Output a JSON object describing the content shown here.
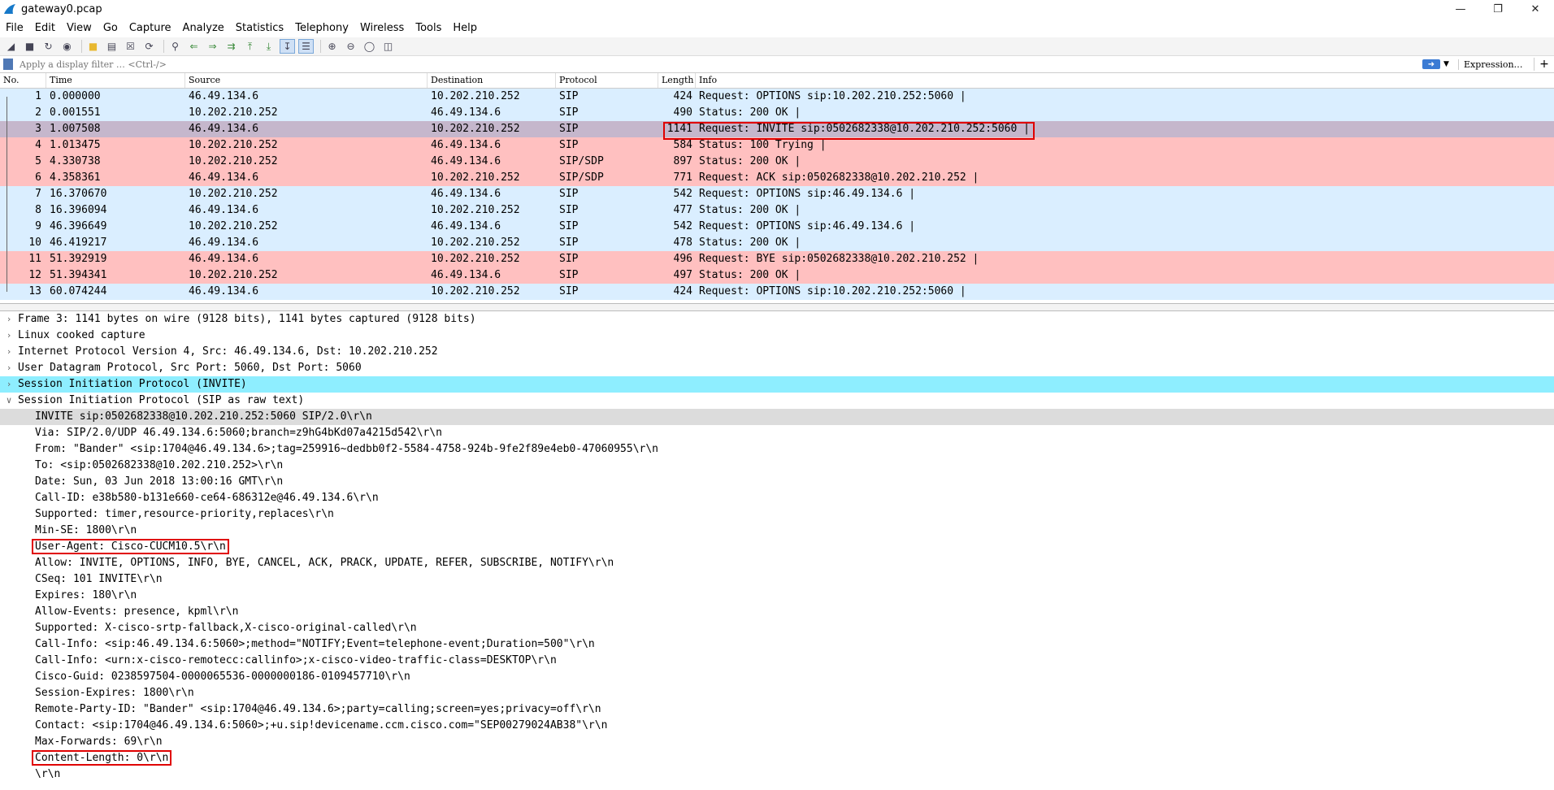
{
  "window": {
    "title": "gateway0.pcap"
  },
  "menu": [
    "File",
    "Edit",
    "View",
    "Go",
    "Capture",
    "Analyze",
    "Statistics",
    "Telephony",
    "Wireless",
    "Tools",
    "Help"
  ],
  "filter": {
    "placeholder": "Apply a display filter … <Ctrl-/>",
    "expression_label": "Expression…",
    "plus": "+"
  },
  "columns": {
    "no": "No.",
    "time": "Time",
    "source": "Source",
    "destination": "Destination",
    "protocol": "Protocol",
    "length": "Length",
    "info": "Info"
  },
  "packets": [
    {
      "no": "1",
      "time": "0.000000",
      "src": "46.49.134.6",
      "dst": "10.202.210.252",
      "proto": "SIP",
      "len": "424",
      "info": "Request: OPTIONS sip:10.202.210.252:5060 |",
      "color": "blue"
    },
    {
      "no": "2",
      "time": "0.001551",
      "src": "10.202.210.252",
      "dst": "46.49.134.6",
      "proto": "SIP",
      "len": "490",
      "info": "Status: 200 OK |",
      "color": "blue"
    },
    {
      "no": "3",
      "time": "1.007508",
      "src": "46.49.134.6",
      "dst": "10.202.210.252",
      "proto": "SIP",
      "len": "1141",
      "info": "Request: INVITE sip:0502682338@10.202.210.252:5060 |",
      "color": "selected"
    },
    {
      "no": "4",
      "time": "1.013475",
      "src": "10.202.210.252",
      "dst": "46.49.134.6",
      "proto": "SIP",
      "len": "584",
      "info": "Status: 100 Trying |",
      "color": "red"
    },
    {
      "no": "5",
      "time": "4.330738",
      "src": "10.202.210.252",
      "dst": "46.49.134.6",
      "proto": "SIP/SDP",
      "len": "897",
      "info": "Status: 200 OK |",
      "color": "red"
    },
    {
      "no": "6",
      "time": "4.358361",
      "src": "46.49.134.6",
      "dst": "10.202.210.252",
      "proto": "SIP/SDP",
      "len": "771",
      "info": "Request: ACK sip:0502682338@10.202.210.252 |",
      "color": "red"
    },
    {
      "no": "7",
      "time": "16.370670",
      "src": "10.202.210.252",
      "dst": "46.49.134.6",
      "proto": "SIP",
      "len": "542",
      "info": "Request: OPTIONS sip:46.49.134.6 |",
      "color": "blue"
    },
    {
      "no": "8",
      "time": "16.396094",
      "src": "46.49.134.6",
      "dst": "10.202.210.252",
      "proto": "SIP",
      "len": "477",
      "info": "Status: 200 OK |",
      "color": "blue"
    },
    {
      "no": "9",
      "time": "46.396649",
      "src": "10.202.210.252",
      "dst": "46.49.134.6",
      "proto": "SIP",
      "len": "542",
      "info": "Request: OPTIONS sip:46.49.134.6 |",
      "color": "blue"
    },
    {
      "no": "10",
      "time": "46.419217",
      "src": "46.49.134.6",
      "dst": "10.202.210.252",
      "proto": "SIP",
      "len": "478",
      "info": "Status: 200 OK |",
      "color": "blue"
    },
    {
      "no": "11",
      "time": "51.392919",
      "src": "46.49.134.6",
      "dst": "10.202.210.252",
      "proto": "SIP",
      "len": "496",
      "info": "Request: BYE sip:0502682338@10.202.210.252 |",
      "color": "red"
    },
    {
      "no": "12",
      "time": "51.394341",
      "src": "10.202.210.252",
      "dst": "46.49.134.6",
      "proto": "SIP",
      "len": "497",
      "info": "Status: 200 OK |",
      "color": "red"
    },
    {
      "no": "13",
      "time": "60.074244",
      "src": "46.49.134.6",
      "dst": "10.202.210.252",
      "proto": "SIP",
      "len": "424",
      "info": "Request: OPTIONS sip:10.202.210.252:5060 |",
      "color": "blue"
    }
  ],
  "details": {
    "layers": [
      {
        "text": "Frame 3: 1141 bytes on wire (9128 bits), 1141 bytes captured (9128 bits)",
        "expanded": false,
        "highlight": false
      },
      {
        "text": "Linux cooked capture",
        "expanded": false,
        "highlight": false
      },
      {
        "text": "Internet Protocol Version 4, Src: 46.49.134.6, Dst: 10.202.210.252",
        "expanded": false,
        "highlight": false
      },
      {
        "text": "User Datagram Protocol, Src Port: 5060, Dst Port: 5060",
        "expanded": false,
        "highlight": false
      },
      {
        "text": "Session Initiation Protocol (INVITE)",
        "expanded": false,
        "highlight": true
      },
      {
        "text": "Session Initiation Protocol (SIP as raw text)",
        "expanded": true,
        "highlight": false
      }
    ],
    "sip_lines": [
      {
        "text": "INVITE sip:0502682338@10.202.210.252:5060 SIP/2.0\\r\\n",
        "style": "grey"
      },
      {
        "text": "Via: SIP/2.0/UDP 46.49.134.6:5060;branch=z9hG4bKd07a4215d542\\r\\n",
        "style": ""
      },
      {
        "text": "From: \"Bander\" <sip:1704@46.49.134.6>;tag=259916~dedbb0f2-5584-4758-924b-9fe2f89e4eb0-47060955\\r\\n",
        "style": ""
      },
      {
        "text": "To: <sip:0502682338@10.202.210.252>\\r\\n",
        "style": ""
      },
      {
        "text": "Date: Sun, 03 Jun 2018 13:00:16 GMT\\r\\n",
        "style": ""
      },
      {
        "text": "Call-ID: e38b580-b131e660-ce64-686312e@46.49.134.6\\r\\n",
        "style": ""
      },
      {
        "text": "Supported: timer,resource-priority,replaces\\r\\n",
        "style": ""
      },
      {
        "text": "Min-SE:  1800\\r\\n",
        "style": ""
      },
      {
        "text": "User-Agent: Cisco-CUCM10.5\\r\\n",
        "style": "boxed"
      },
      {
        "text": "Allow: INVITE, OPTIONS, INFO, BYE, CANCEL, ACK, PRACK, UPDATE, REFER, SUBSCRIBE, NOTIFY\\r\\n",
        "style": ""
      },
      {
        "text": "CSeq: 101 INVITE\\r\\n",
        "style": ""
      },
      {
        "text": "Expires: 180\\r\\n",
        "style": ""
      },
      {
        "text": "Allow-Events: presence, kpml\\r\\n",
        "style": ""
      },
      {
        "text": "Supported: X-cisco-srtp-fallback,X-cisco-original-called\\r\\n",
        "style": ""
      },
      {
        "text": "Call-Info: <sip:46.49.134.6:5060>;method=\"NOTIFY;Event=telephone-event;Duration=500\"\\r\\n",
        "style": ""
      },
      {
        "text": "Call-Info: <urn:x-cisco-remotecc:callinfo>;x-cisco-video-traffic-class=DESKTOP\\r\\n",
        "style": ""
      },
      {
        "text": "Cisco-Guid: 0238597504-0000065536-0000000186-0109457710\\r\\n",
        "style": ""
      },
      {
        "text": "Session-Expires:  1800\\r\\n",
        "style": ""
      },
      {
        "text": "Remote-Party-ID: \"Bander\" <sip:1704@46.49.134.6>;party=calling;screen=yes;privacy=off\\r\\n",
        "style": ""
      },
      {
        "text": "Contact: <sip:1704@46.49.134.6:5060>;+u.sip!devicename.ccm.cisco.com=\"SEP00279024AB38\"\\r\\n",
        "style": ""
      },
      {
        "text": "Max-Forwards: 69\\r\\n",
        "style": ""
      },
      {
        "text": "Content-Length: 0\\r\\n",
        "style": "boxed"
      },
      {
        "text": "\\r\\n",
        "style": ""
      }
    ]
  },
  "colors": {
    "row_blue": "#daeeff",
    "row_red": "#ffc0c0",
    "row_selected": "#c5b7cc",
    "highlight_cyan": "#8eeeff",
    "annotation_red": "#e00000"
  }
}
